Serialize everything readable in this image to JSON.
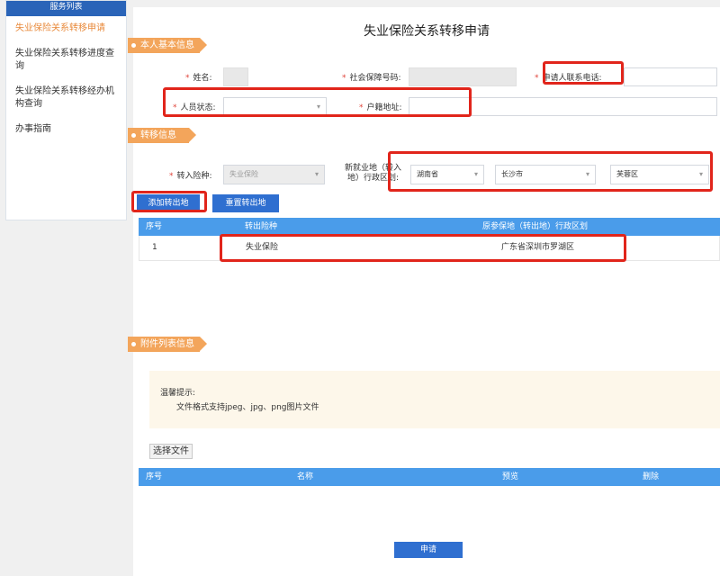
{
  "sidebar": {
    "header": "服务列表",
    "items": [
      {
        "label": "失业保险关系转移申请",
        "active": true
      },
      {
        "label": "失业保险关系转移进度查询",
        "active": false
      },
      {
        "label": "失业保险关系转移经办机构查询",
        "active": false
      },
      {
        "label": "办事指南",
        "active": false
      }
    ]
  },
  "page": {
    "title": "失业保险关系转移申请"
  },
  "basic_info": {
    "section_label": "本人基本信息",
    "name_label": "姓名:",
    "ssn_label": "社会保障号码:",
    "phone_label": "申请人联系电话:",
    "status_label": "人员状态:",
    "hukou_label": "户籍地址:",
    "required_mark": "*"
  },
  "transfer_info": {
    "section_label": "转移信息",
    "insurance_label": "转入险种:",
    "insurance_value": "失业保险",
    "new_location_label_1": "新就业地（转入",
    "new_location_label_2": "地）行政区划:",
    "province": "湖南省",
    "city": "长沙市",
    "district": "芙蓉区",
    "add_button": "添加转出地",
    "reset_button": "重置转出地"
  },
  "transfer_table": {
    "headers": [
      "序号",
      "转出险种",
      "原参保地（转出地）行政区划"
    ],
    "rows": [
      {
        "index": "1",
        "insurance": "失业保险",
        "region": "广东省深圳市罗湖区"
      }
    ]
  },
  "attachments": {
    "section_label": "附件列表信息",
    "tip_title": "温馨提示:",
    "tip_text": "文件格式支持jpeg、jpg、png图片文件",
    "choose_file_button": "选择文件",
    "headers": [
      "序号",
      "名称",
      "预览",
      "删除"
    ]
  },
  "submit_button": "申请",
  "colors": {
    "accent_orange": "#f3a55b",
    "primary_blue": "#2f6fd0",
    "table_header": "#4a9cea",
    "highlight_red": "#e1251b"
  }
}
